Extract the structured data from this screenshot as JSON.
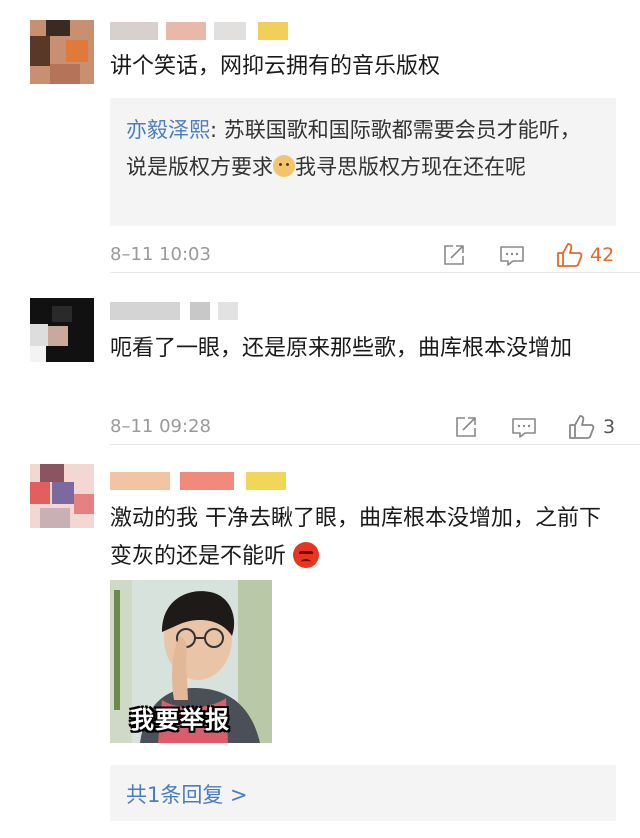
{
  "comments": [
    {
      "text": "讲个笑话，网抑云拥有的音乐版权",
      "quote": {
        "author": "亦毅泽熙",
        "separator": ": ",
        "text_part1": "苏联国歌和国际歌都需要会员才能听，说是版权方要求",
        "emoji": "doge-emoji",
        "text_part2": "我寻思版权方现在还在呢"
      },
      "time": "8–11 10:03",
      "like_count": "42",
      "liked": true
    },
    {
      "text": "呃看了一眼，还是原来那些歌，曲库根本没增加",
      "time": "8–11 09:28",
      "like_count": "3",
      "liked": false
    },
    {
      "text": "激动的我 干净去瞅了眼，曲库根本没增加，之前下变灰的还是不能听",
      "emoji": "angry-emoji",
      "picture_caption": "我要举报"
    }
  ],
  "reply_summary": "共1条回复 >",
  "colors": {
    "link": "#4a7cc0",
    "liked": "#e5672d",
    "meta": "#9a9a9a"
  }
}
